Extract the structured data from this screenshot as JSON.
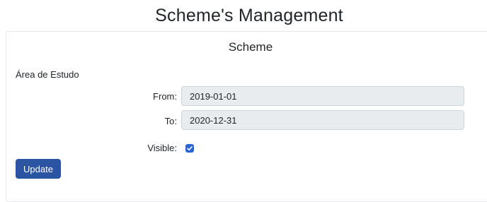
{
  "page": {
    "title": "Scheme's Management"
  },
  "card": {
    "title": "Scheme",
    "field_name": "Área de Estudo",
    "from_label": "From:",
    "from_value": "2019-01-01",
    "to_label": "To:",
    "to_value": "2020-12-31",
    "visible_label": "Visible:",
    "visible_checked": true,
    "update_label": "Update"
  },
  "colors": {
    "primary_button": "#2b54a3",
    "checkbox": "#2a63d4",
    "input_background": "#e9ecef"
  }
}
